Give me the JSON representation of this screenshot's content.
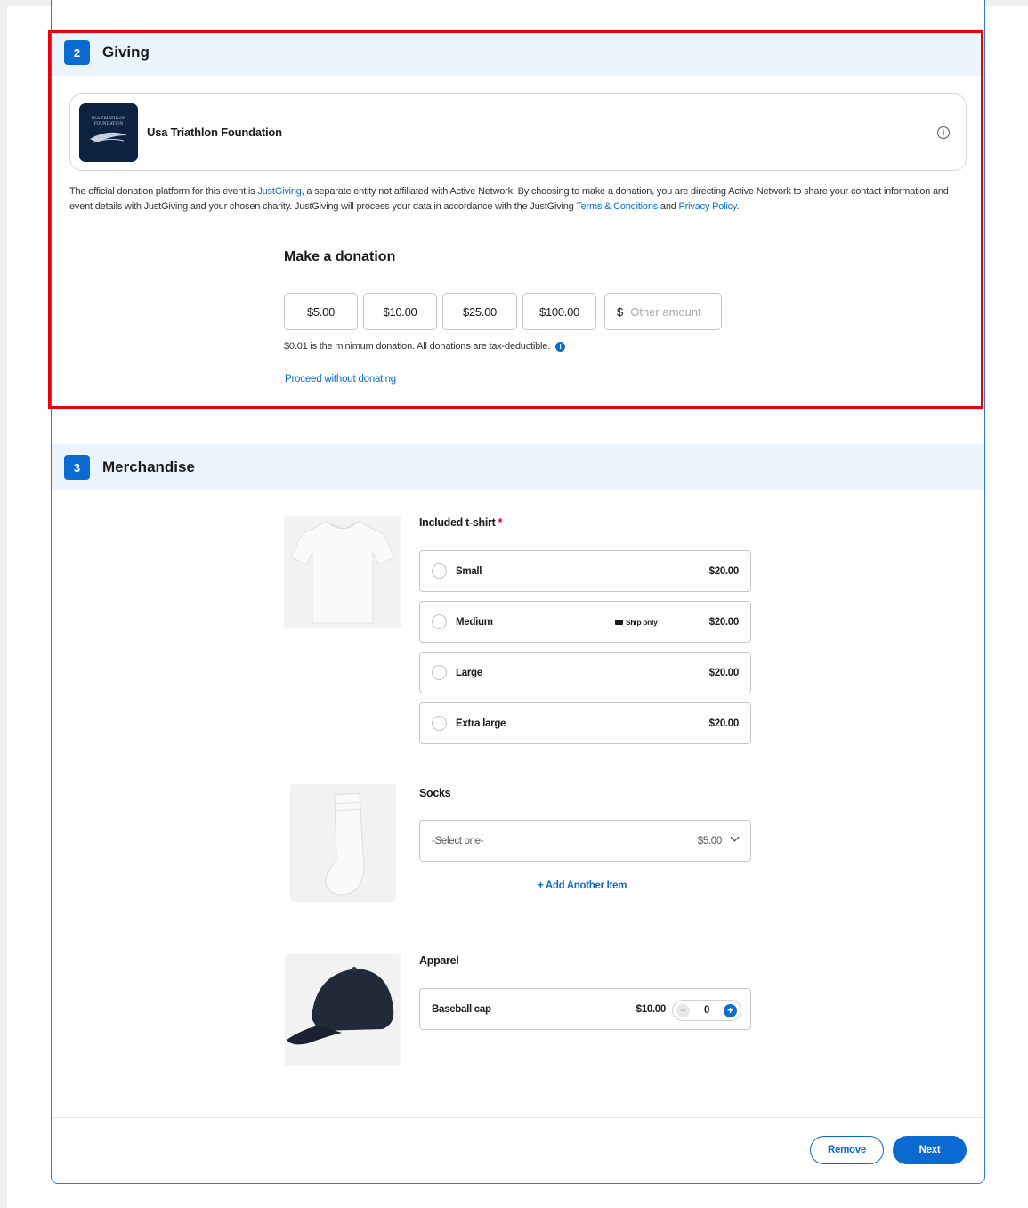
{
  "giving": {
    "step_number": "2",
    "title": "Giving",
    "charity_name": "Usa Triathlon Foundation",
    "logo_text": "USA TRIATHLON FOUNDATION",
    "disclaimer": {
      "part1": "The official donation platform for this event is ",
      "link_justgiving": "JustGiving",
      "part2": ", a separate entity not affiliated with Active Network. By choosing to make a donation, you are directing Active Network to share your contact information and event details with JustGiving and your chosen charity. JustGiving will process your data in accordance with the JustGiving ",
      "link_terms": "Terms & Conditions",
      "part3": " and ",
      "link_privacy": "Privacy Policy",
      "part4": "."
    },
    "donation_title": "Make a donation",
    "amounts": [
      "$5.00",
      "$10.00",
      "$25.00",
      "$100.00"
    ],
    "other_currency": "$",
    "other_placeholder": "Other amount",
    "min_note": "$0.01 is the minimum donation. All donations are tax-deductible.",
    "proceed_label": "Proceed without donating"
  },
  "merchandise": {
    "step_number": "3",
    "title": "Merchandise",
    "tshirt": {
      "label": "Included t-shirt",
      "required_mark": "*",
      "options": [
        {
          "name": "Small",
          "price": "$20.00"
        },
        {
          "name": "Medium",
          "price": "$20.00",
          "badge": "Ship only"
        },
        {
          "name": "Large",
          "price": "$20.00"
        },
        {
          "name": "Extra large",
          "price": "$20.00"
        }
      ]
    },
    "socks": {
      "label": "Socks",
      "select_value": "-Select one-",
      "price": "$5.00",
      "add_another": "+ Add Another Item"
    },
    "apparel": {
      "label": "Apparel",
      "item_name": "Baseball cap",
      "price": "$10.00",
      "quantity": "0",
      "minus": "–",
      "plus": "+"
    }
  },
  "footer": {
    "remove_label": "Remove",
    "next_label": "Next"
  },
  "colors": {
    "accent": "#0b6bd1",
    "highlight": "#e8000d",
    "section_bg": "#ebf3fb"
  }
}
